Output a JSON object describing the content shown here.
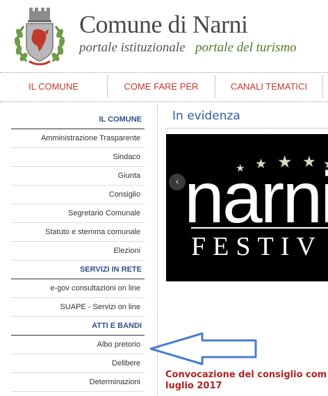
{
  "header": {
    "title": "Comune di Narni",
    "subtitle_left": "portale istituzionale",
    "subtitle_right": "portale del turismo"
  },
  "topnav": {
    "items": [
      "IL COMUNE",
      "COME FARE PER",
      "CANALI TEMATICI"
    ]
  },
  "sidebar": {
    "section1": {
      "heading": "IL COMUNE",
      "items": [
        "Amministrazione Trasparente",
        "Sindaco",
        "Giunta",
        "Consiglio",
        "Segretario Comunale",
        "Statuto e stemma comunale",
        "Elezioni"
      ]
    },
    "section2": {
      "heading": "SERVIZI IN RETE",
      "items": [
        "e-gov consultazioni on line",
        "SUAPE - Servizi on line"
      ]
    },
    "section3": {
      "heading": "ATTI E BANDI",
      "items": [
        "Albo pretorio",
        "Delibere",
        "Determinazioni"
      ]
    }
  },
  "main": {
    "heading": "In evidenza",
    "banner": {
      "brand": "narni",
      "subtitle": "FESTIV",
      "prev_glyph": "‹",
      "star_glyph": "★"
    },
    "news_title_line1": "Convocazione del consiglio com",
    "news_title_line2": "luglio 2017"
  },
  "colors": {
    "accent_red": "#c0392b",
    "link_blue": "#2f4f8f",
    "heading_blue": "#2f5f9f",
    "green": "#4f7d2c",
    "arrow_blue": "#4a7bd0"
  }
}
